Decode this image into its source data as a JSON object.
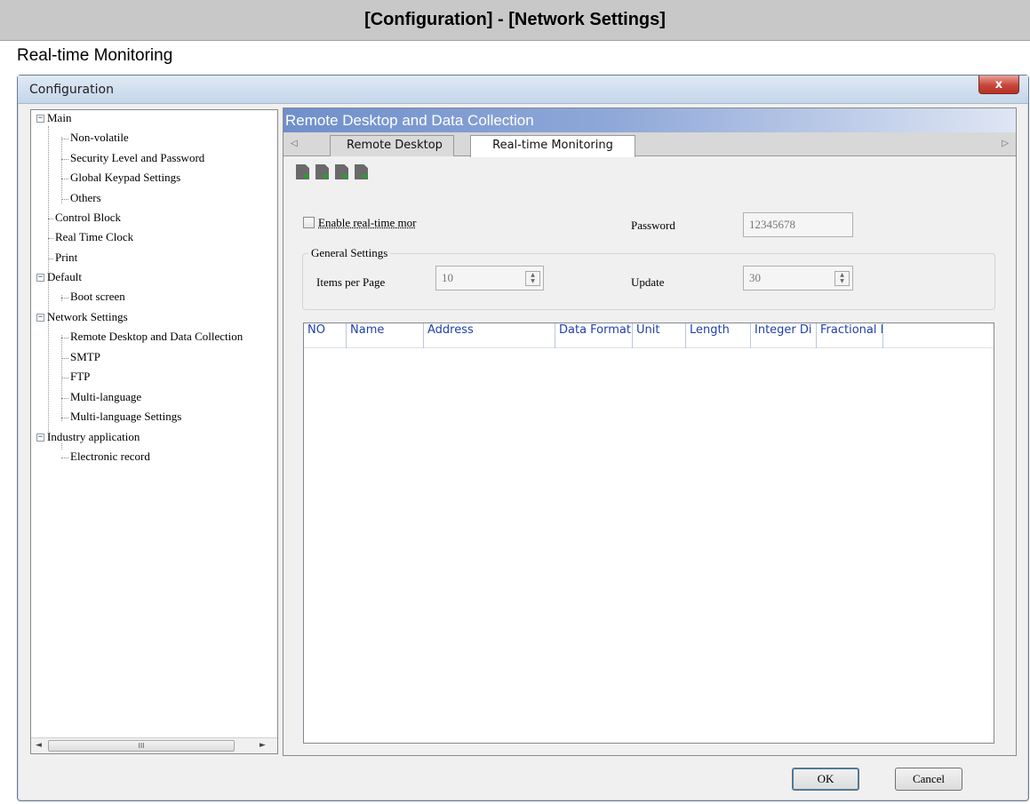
{
  "doc": {
    "header": "[Configuration] - [Network Settings]",
    "subtitle": "Real-time Monitoring"
  },
  "window": {
    "title": "Configuration",
    "close_symbol": "x"
  },
  "tree": [
    {
      "label": "Main",
      "toggle": "−"
    },
    {
      "label": "Non-volatile"
    },
    {
      "label": "Security Level and Password"
    },
    {
      "label": "Global Keypad Settings"
    },
    {
      "label": "Others"
    },
    {
      "label": "Control Block"
    },
    {
      "label": "Real Time Clock"
    },
    {
      "label": "Print"
    },
    {
      "label": "Default",
      "toggle": "−"
    },
    {
      "label": "Boot screen"
    },
    {
      "label": "Network Settings",
      "toggle": "−"
    },
    {
      "label": "Remote Desktop and Data Collection"
    },
    {
      "label": "SMTP"
    },
    {
      "label": "FTP"
    },
    {
      "label": "Multi-language"
    },
    {
      "label": "Multi-language Settings"
    },
    {
      "label": "Industry application",
      "toggle": "−"
    },
    {
      "label": "Electronic record"
    }
  ],
  "tree_scroll": {
    "left": "◄",
    "right": "►",
    "thumb": "III"
  },
  "panel": {
    "title": "Remote Desktop and Data Collection",
    "tab_left_arrow": "◁",
    "tab_right_arrow": "▷",
    "tabs": [
      {
        "label": "Remote Desktop",
        "active": false
      },
      {
        "label": "Real-time Monitoring",
        "active": true
      }
    ],
    "toolbar_icons": [
      "add-row-icon",
      "delete-row-icon",
      "move-up-icon",
      "move-down-icon"
    ]
  },
  "form": {
    "enable_label": "Enable real-time mor",
    "enable_checked": false,
    "password_label": "Password",
    "password_value": "12345678",
    "group_title": "General Settings",
    "items_per_page_label": "Items per Page",
    "items_per_page_value": "10",
    "update_label": "Update",
    "update_value": "30"
  },
  "grid_columns": [
    "NO",
    "Name",
    "Address",
    "Data Format",
    "Unit",
    "Length",
    "Integer Di",
    "Fractional I"
  ],
  "buttons": {
    "ok": "OK",
    "cancel": "Cancel"
  }
}
